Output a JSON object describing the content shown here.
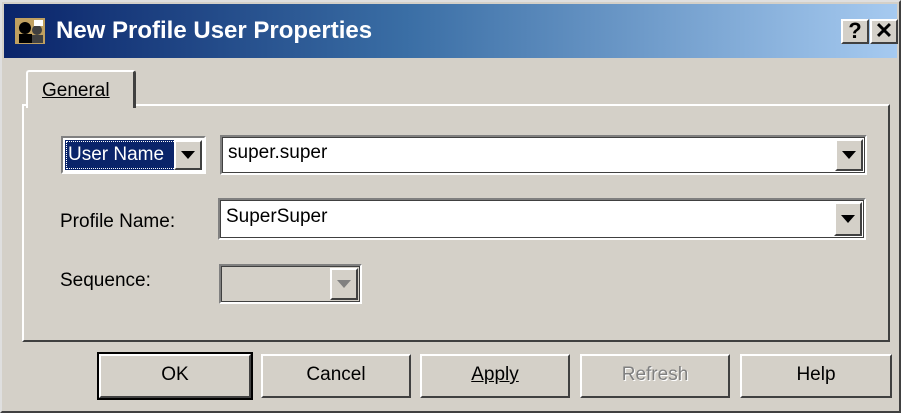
{
  "window": {
    "title": "New Profile User Properties"
  },
  "caption_buttons": {
    "help": "?",
    "close": "✕"
  },
  "tabs": [
    {
      "label": "General"
    }
  ],
  "form": {
    "key_type": {
      "value": "User Name"
    },
    "key_value": {
      "value": "super.super"
    },
    "profile_name": {
      "label": "Profile Name:",
      "value": "SuperSuper"
    },
    "sequence": {
      "label": "Sequence:",
      "value": "",
      "disabled": true
    }
  },
  "buttons": {
    "ok": "OK",
    "cancel": "Cancel",
    "apply": "Apply",
    "refresh": "Refresh",
    "help": "Help"
  },
  "colors": {
    "titlebar_start": "#0a246a",
    "titlebar_end": "#a6caf0",
    "face": "#d4d0c8",
    "selection": "#0a246a"
  },
  "icons": {
    "app": "profile-window-icon",
    "dropdown": "chevron-down-icon"
  }
}
